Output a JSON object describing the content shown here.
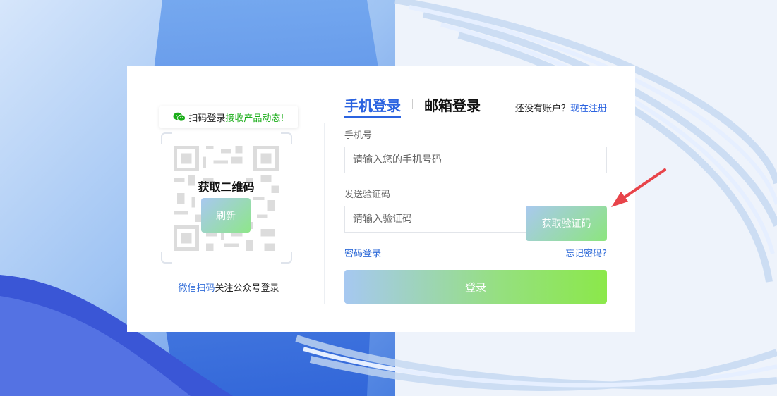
{
  "wechat_panel": {
    "banner_prefix": "扫码登录",
    "banner_highlight": "接收产品动态!",
    "qr_overlay_title": "获取二维码",
    "refresh_label": "刷新",
    "footer_link": "微信扫码",
    "footer_text": "关注公众号登录"
  },
  "tabs": {
    "phone_label": "手机登录",
    "email_label": "邮箱登录"
  },
  "register": {
    "prompt": "还没有账户？",
    "link": "现在注册"
  },
  "form": {
    "phone_label": "手机号",
    "phone_placeholder": "请输入您的手机号码",
    "code_label": "发送验证码",
    "code_placeholder": "请输入验证码",
    "get_code_label": "获取验证码",
    "password_login_link": "密码登录",
    "forgot_password_link": "忘记密码?",
    "login_label": "登录"
  },
  "colors": {
    "accent_blue": "#2b63e0",
    "wechat_green": "#1aad19"
  },
  "icons": [
    "wechat-icon",
    "qr-code-image",
    "annotation-arrow"
  ]
}
